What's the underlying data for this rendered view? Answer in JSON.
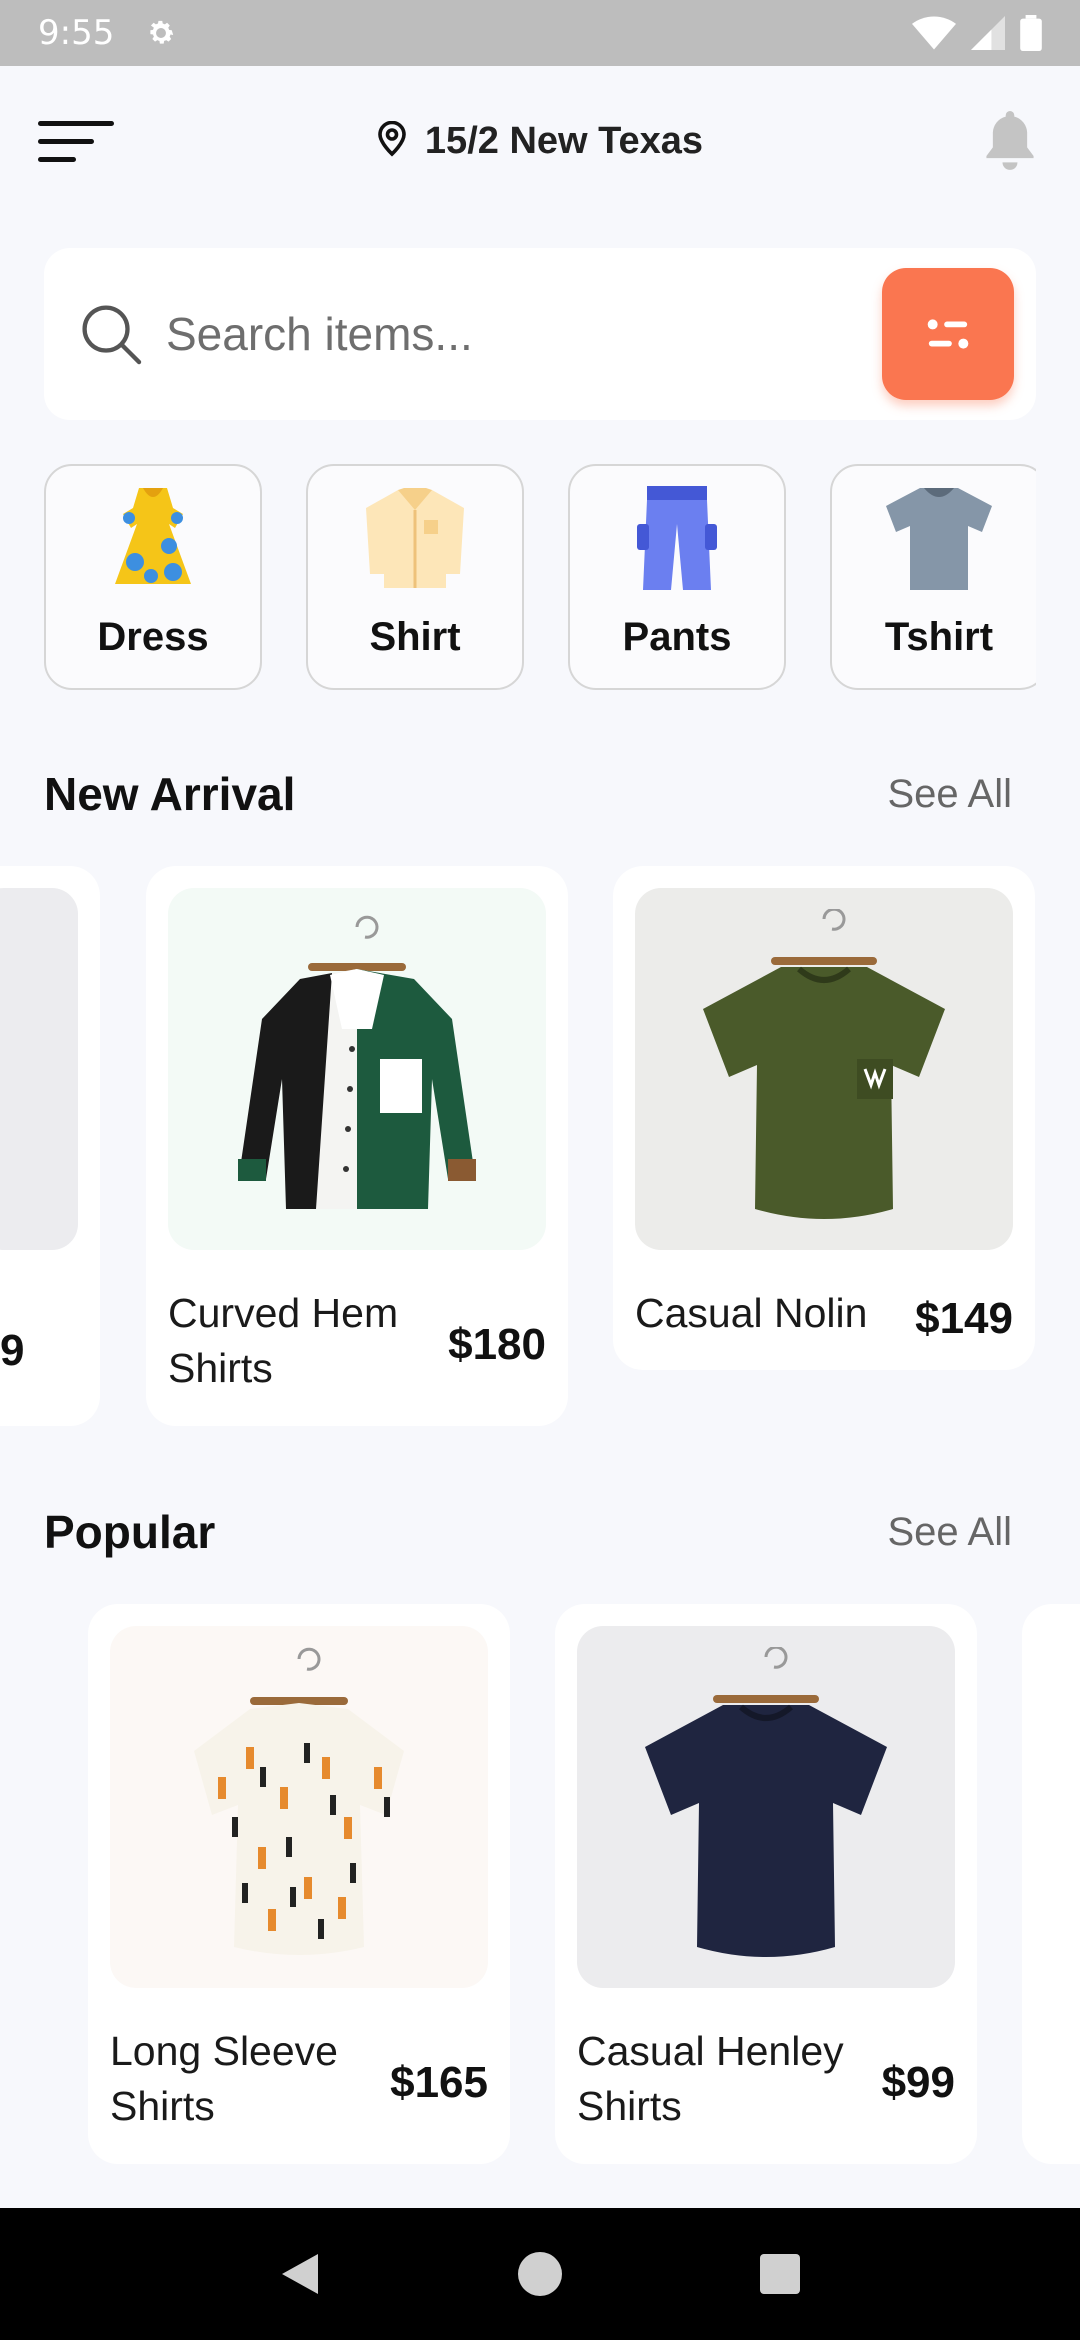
{
  "status_bar": {
    "time": "9:55"
  },
  "header": {
    "location": "15/2 New Texas"
  },
  "search": {
    "placeholder": "Search items..."
  },
  "categories": [
    {
      "label": "Dress",
      "icon": "dress-icon"
    },
    {
      "label": "Shirt",
      "icon": "shirt-icon"
    },
    {
      "label": "Pants",
      "icon": "pants-icon"
    },
    {
      "label": "Tshirt",
      "icon": "tshirt-icon"
    }
  ],
  "new_arrival": {
    "title": "New Arrival",
    "see_all": "See All",
    "partial_price": "9",
    "items": [
      {
        "name": "Curved Hem Shirts",
        "price": "$180"
      },
      {
        "name": "Casual Nolin",
        "price": "$149"
      }
    ]
  },
  "popular": {
    "title": "Popular",
    "see_all": "See All",
    "items": [
      {
        "name": "Long Sleeve Shirts",
        "price": "$165"
      },
      {
        "name": "Casual Henley Shirts",
        "price": "$99"
      }
    ]
  },
  "colors": {
    "accent": "#fa7650",
    "background": "#f7f8fc"
  }
}
